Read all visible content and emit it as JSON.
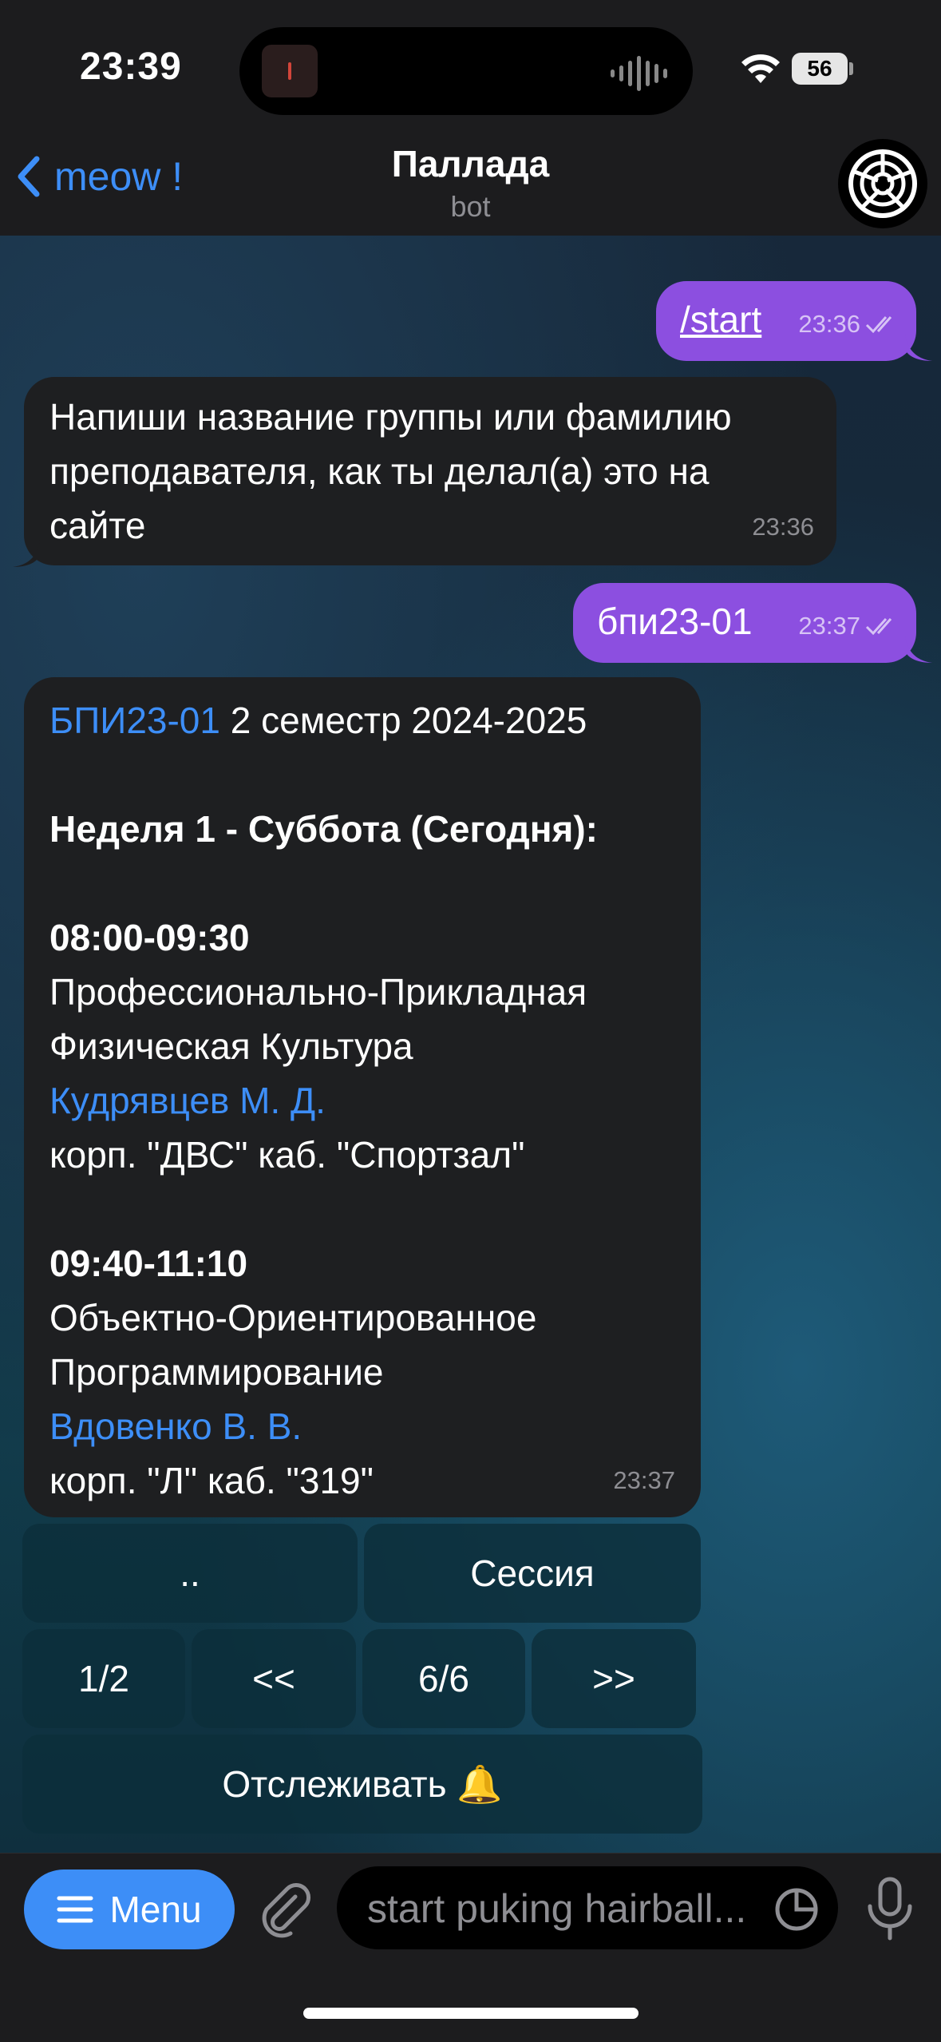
{
  "status_bar": {
    "time": "23:39",
    "battery": "56"
  },
  "header": {
    "back_label": "meow !",
    "title": "Паллада",
    "subtitle": "bot"
  },
  "messages": {
    "m1": {
      "text": "/start",
      "time": "23:36"
    },
    "m2": {
      "line1": "Напиши название группы или фамилию",
      "line2": "преподавателя, как ты делал(а) это на",
      "line3": "сайте",
      "time": "23:36"
    },
    "m3": {
      "text": "бпи23-01",
      "time": "23:37"
    },
    "m4": {
      "group_link": "БПИ23-01",
      "semester": " 2 семестр 2024-2025",
      "week_day": "Неделя 1 - Суббота (Сегодня):",
      "lesson1": {
        "time": "08:00-09:30",
        "subject_line1": "Профессионально-Прикладная",
        "subject_line2": "Физическая Культура",
        "teacher": "Кудрявцев М. Д.",
        "room": "корп. \"ДВС\" каб. \"Спортзал\""
      },
      "lesson2": {
        "time": "09:40-11:10",
        "subject_line1": "Объектно-Ориентированное",
        "subject_line2": "Программирование",
        "teacher": "Вдовенко В. В.",
        "room": "корп. \"Л\" каб. \"319\""
      },
      "time": "23:37"
    }
  },
  "keyboard": {
    "up": "..",
    "session": "Сессия",
    "page": "1/2",
    "prev": "<<",
    "week": "6/6",
    "next": ">>",
    "track": "Отслеживать 🔔"
  },
  "input_bar": {
    "menu_label": "Menu",
    "placeholder": "start puking hairball..."
  },
  "colors": {
    "accent": "#3d8ef7",
    "outgoing_bubble": "#8c4fe0",
    "incoming_bubble": "#1e1f21"
  },
  "icons": [
    "back-chevron-icon",
    "wifi-icon",
    "double-check-icon",
    "hamburger-icon",
    "paperclip-icon",
    "sticker-icon",
    "microphone-icon"
  ]
}
